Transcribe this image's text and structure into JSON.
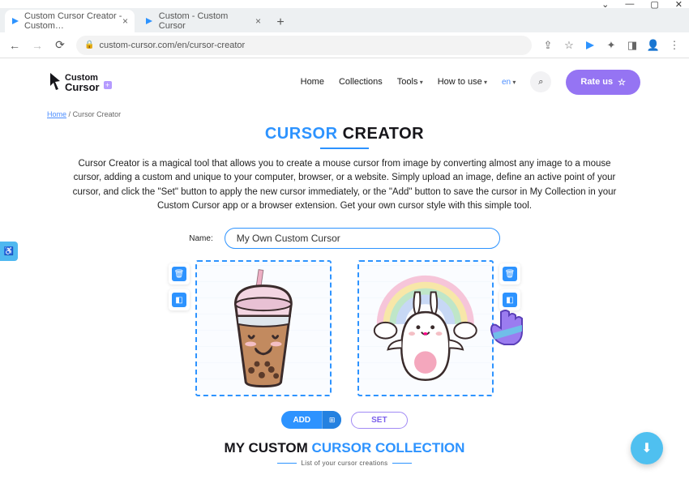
{
  "window": {
    "controls": {
      "min": "—",
      "max": "▢",
      "close": "✕"
    }
  },
  "browser": {
    "tabs": [
      {
        "title": "Custom Cursor Creator - Custom…",
        "active": true
      },
      {
        "title": "Custom - Custom Cursor",
        "active": false
      }
    ],
    "url": "custom-cursor.com/en/cursor-creator"
  },
  "nav": {
    "home": "Home",
    "collections": "Collections",
    "tools": "Tools",
    "howto": "How to use",
    "lang": "en",
    "rate": "Rate us"
  },
  "breadcrumb": {
    "home": "Home",
    "sep": "/",
    "current": "Cursor Creator"
  },
  "title": {
    "a": "CURSOR",
    "b": " CREATOR"
  },
  "description": "Cursor Creator is a magical tool that allows you to create a mouse cursor from image by converting almost any image to a mouse cursor, adding a custom and unique to your computer, browser, or a website. Simply upload an image, define an active point of your cursor, and click the \"Set\" button to apply the new cursor immediately, or the \"Add\" button to save the cursor in My Collection in your Custom Cursor app or a browser extension. Get your own cursor style with this simple tool.",
  "form": {
    "name_label": "Name:",
    "name_value": "My Own Custom Cursor"
  },
  "actions": {
    "add": "ADD",
    "set": "SET"
  },
  "collection": {
    "title_a": "MY CUSTOM ",
    "title_b": "CURSOR COLLECTION",
    "subtitle": "List of your cursor creations"
  }
}
